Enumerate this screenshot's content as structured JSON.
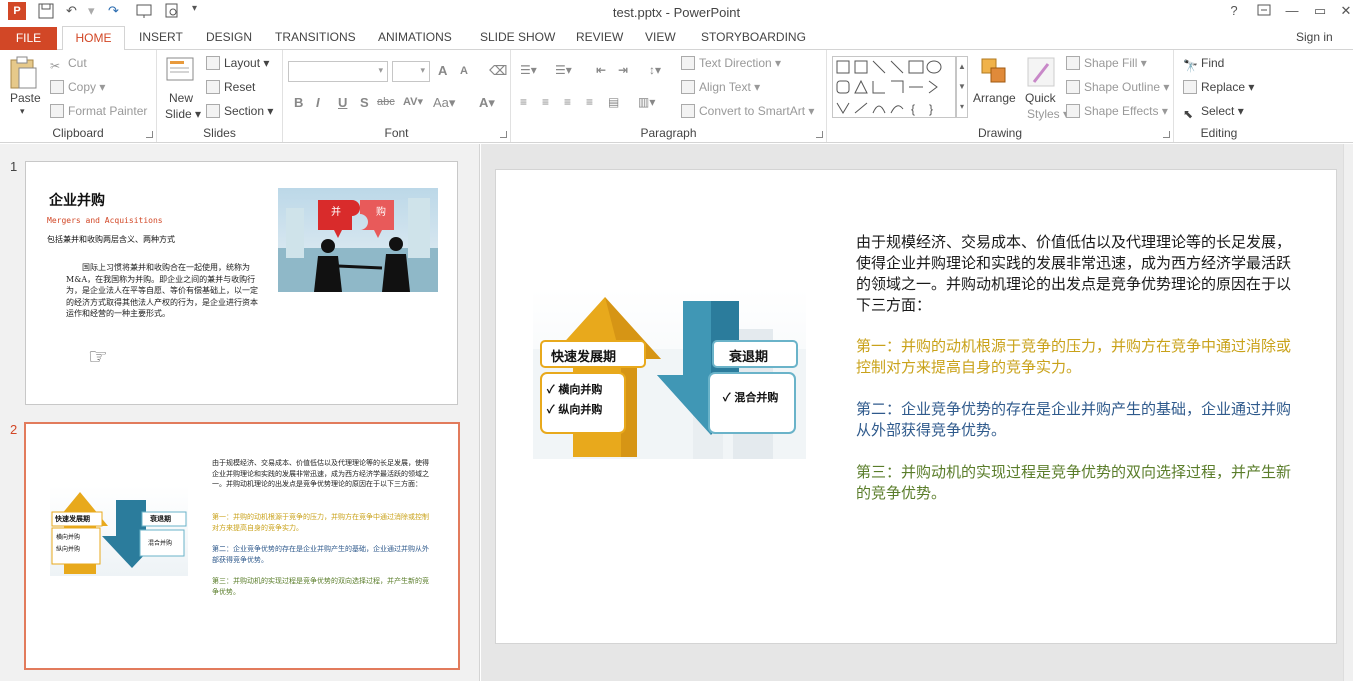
{
  "window": {
    "title": "test.pptx - PowerPoint",
    "help": "?",
    "minimize": "—",
    "restore": "▭",
    "close": "✕"
  },
  "qat": {
    "save_icon": "save-icon",
    "undo_icon": "undo-icon",
    "redo_icon": "redo-icon"
  },
  "tabs": [
    "FILE",
    "HOME",
    "INSERT",
    "DESIGN",
    "TRANSITIONS",
    "ANIMATIONS",
    "SLIDE SHOW",
    "REVIEW",
    "VIEW",
    "STORYBOARDING"
  ],
  "signin": "Sign in",
  "ribbon": {
    "clipboard": {
      "label": "Clipboard",
      "paste": "Paste",
      "cut": "Cut",
      "copy": "Copy",
      "format_painter": "Format Painter"
    },
    "slides": {
      "label": "Slides",
      "new_slide_1": "New",
      "new_slide_2": "Slide",
      "layout": "Layout",
      "reset": "Reset",
      "section": "Section"
    },
    "font": {
      "label": "Font",
      "bold": "B",
      "italic": "I",
      "underline": "U",
      "shadow": "S",
      "strike": "abc",
      "aa": "Aa",
      "grow": "A",
      "shrink": "A",
      "color": "A"
    },
    "paragraph": {
      "label": "Paragraph",
      "text_direction": "Text Direction",
      "align_text": "Align Text",
      "convert": "Convert to SmartArt"
    },
    "drawing": {
      "label": "Drawing",
      "arrange": "Arrange",
      "quick_1": "Quick",
      "quick_2": "Styles",
      "shape_fill": "Shape Fill",
      "shape_outline": "Shape Outline",
      "shape_effects": "Shape Effects"
    },
    "editing": {
      "label": "Editing",
      "find": "Find",
      "replace": "Replace",
      "select": "Select"
    }
  },
  "thumbnails": [
    {
      "number": "1",
      "title": "企业并购",
      "subtitle": "Mergers and Acquisitions",
      "line": "包括兼并和收购两层含义、两种方式",
      "body": "国际上习惯将兼并和收购合在一起使用，统称为M&A，在我国称为并购。即企业之间的兼并与收购行为，是企业法人在平等自愿、等价有偿基础上，以一定的经济方式取得其他法人产权的行为，是企业进行资本运作和经营的一种主要形式。",
      "puzzle_left": "并",
      "puzzle_right": "购"
    },
    {
      "number": "2"
    }
  ],
  "slide": {
    "graphic": {
      "left_title": "快速发展期",
      "left_items": [
        "横向并购",
        "纵向并购"
      ],
      "right_title": "衰退期",
      "right_items": [
        "混合并购"
      ],
      "check": "✓"
    },
    "intro": "由于规模经济、交易成本、价值低估以及代理理论等的长足发展，使得企业并购理论和实践的发展非常迅速，成为西方经济学最活跃的领域之一。并购动机理论的出发点是竞争优势理论的原因在于以下三方面：",
    "points": [
      {
        "label": "第一：",
        "text": "并购的动机根源于竞争的压力，并购方在竞争中通过消除或控制对方来提高自身的竞争实力。",
        "color": "#c9a21a"
      },
      {
        "label": "第二：",
        "text": "企业竞争优势的存在是企业并购产生的基础，企业通过并购从外部获得竞争优势。",
        "color": "#2f5a8c"
      },
      {
        "label": "第三：",
        "text": "并购动机的实现过程是竞争优势的双向选择过程，并产生新的竞争优势。",
        "color": "#5a7d2a"
      }
    ]
  },
  "colors": {
    "accent": "#d24726",
    "intro": "#1a1a1a"
  }
}
